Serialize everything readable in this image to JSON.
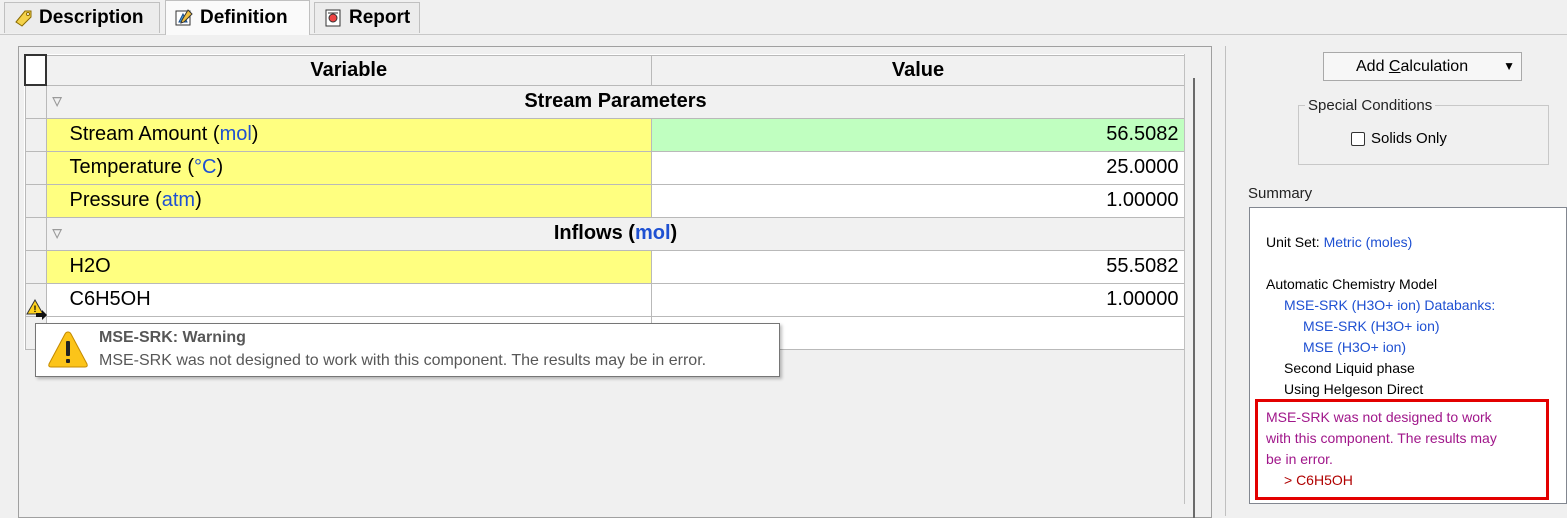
{
  "tabs": [
    {
      "label": "Description",
      "icon": "tag-icon"
    },
    {
      "label": "Definition",
      "icon": "flask-pencil-icon"
    },
    {
      "label": "Report",
      "icon": "report-icon"
    }
  ],
  "grid": {
    "col_variable": "Variable",
    "col_value": "Value",
    "group1": "Stream Parameters",
    "rows1": [
      {
        "name": "Stream Amount (",
        "unit": "mol",
        "close": ")",
        "value": "56.5082"
      },
      {
        "name": "Temperature (",
        "unit": "°C",
        "close": ")",
        "value": "25.0000"
      },
      {
        "name": "Pressure (",
        "unit": "atm",
        "close": ")",
        "value": "1.00000"
      }
    ],
    "group2_pre": "Inflows (",
    "group2_unit": "mol",
    "group2_post": ")",
    "rows2": [
      {
        "name": "H2O",
        "value": "55.5082"
      },
      {
        "name": "C6H5OH",
        "value": "1.00000"
      }
    ]
  },
  "tooltip": {
    "title": "MSE-SRK: Warning",
    "text": "MSE-SRK was not designed to work with this component. The results may be in error."
  },
  "right": {
    "add_calc_pre": "Add ",
    "add_calc_u": "C",
    "add_calc_post": "alculation",
    "special_legend": "Special Conditions",
    "solids_only": "Solids Only",
    "summary_label": "Summary",
    "summary": {
      "unit_set_label": "Unit Set:",
      "unit_set_value": "Metric (moles)",
      "model_title": "Automatic Chemistry Model",
      "databanks": "MSE-SRK (H3O+ ion) Databanks:",
      "db1": "MSE-SRK (H3O+ ion)",
      "db2": "MSE (H3O+ ion)",
      "second_liquid": "Second Liquid phase",
      "helgeson": "Using Helgeson Direct",
      "warn1": "MSE-SRK was not designed to work",
      "warn2": "with this component. The results may",
      "warn3": "be in error.",
      "warn_comp": "> C6H5OH"
    }
  }
}
